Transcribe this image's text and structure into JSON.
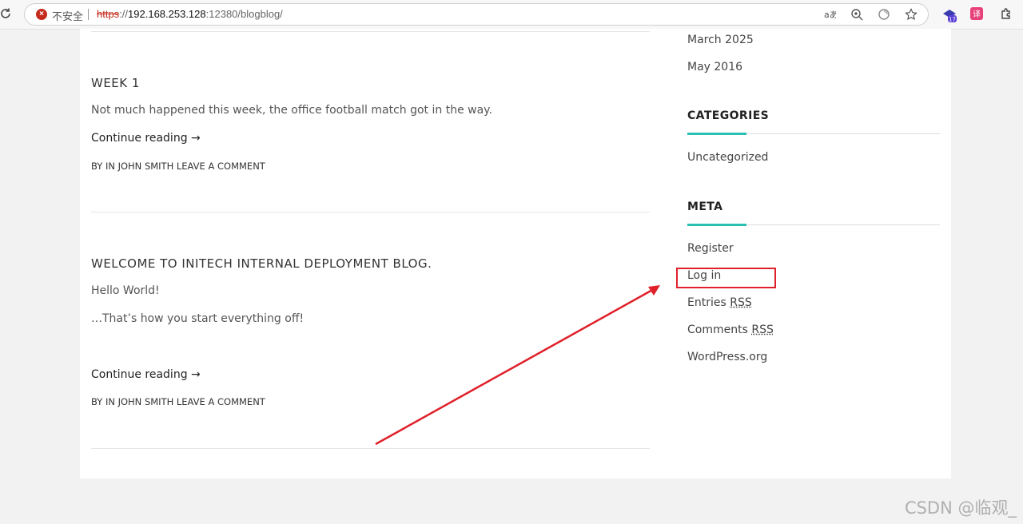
{
  "browser": {
    "insecure_label": "不安全",
    "url_scheme": "https",
    "url_sep": "://",
    "url_host": "192.168.253.128",
    "url_rest": ":12380/blogblog/",
    "icons": [
      "reload-icon",
      "read-aloud-icon",
      "zoom-icon",
      "refresh-tab-icon",
      "favorite-star-icon",
      "extension-badge-icon",
      "translate-extension-icon",
      "extensions-puzzle-icon"
    ],
    "extension_badge_count": "17"
  },
  "posts": [
    {
      "title": "WEEK 1",
      "paragraphs": [
        "Not much happened this week, the office football match got in the way."
      ],
      "continue_label": "Continue reading →",
      "byline": "BY IN JOHN SMITH LEAVE A COMMENT"
    },
    {
      "title": "WELCOME TO INITECH INTERNAL DEPLOYMENT BLOG.",
      "paragraphs": [
        "Hello World!",
        "…That’s how you start everything off!"
      ],
      "continue_label": "Continue reading →",
      "byline": "BY IN JOHN SMITH LEAVE A COMMENT"
    }
  ],
  "sidebar": {
    "archives": [
      "March 2025",
      "May 2016"
    ],
    "categories_title": "CATEGORIES",
    "categories": [
      "Uncategorized"
    ],
    "meta_title": "META",
    "meta": {
      "register": "Register",
      "login": "Log in",
      "entries_prefix": "Entries ",
      "comments_prefix": "Comments ",
      "rss": "RSS",
      "wordpress": "WordPress.org"
    }
  },
  "annotation": {
    "color": "#e0202a"
  },
  "watermark": "CSDN @临观_",
  "colors": {
    "accent": "#2bc0b4",
    "insecure": "#c42b1c"
  }
}
